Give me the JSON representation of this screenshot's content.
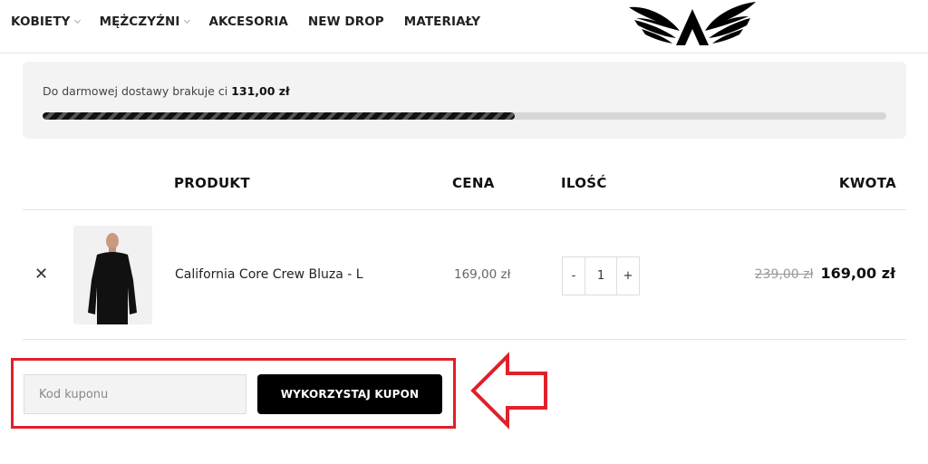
{
  "nav": {
    "items": [
      {
        "label": "KOBIETY",
        "has_dropdown": true
      },
      {
        "label": "MĘŻCZYŹNI",
        "has_dropdown": true
      },
      {
        "label": "AKCESORIA",
        "has_dropdown": false
      },
      {
        "label": "NEW DROP",
        "has_dropdown": false
      },
      {
        "label": "MATERIAŁY",
        "has_dropdown": false
      }
    ],
    "logo_icon": "winged-a-logo"
  },
  "shipping": {
    "text": "Do darmowej dostawy brakuje ci ",
    "amount": "131,00 zł",
    "progress": 0.56
  },
  "cart": {
    "headers": {
      "product": "PRODUKT",
      "price": "CENA",
      "quantity": "ILOŚĆ",
      "amount": "KWOTA"
    },
    "items": [
      {
        "remove_icon": "close-icon",
        "name": "California Core Crew Bluza - L",
        "price": "169,00 zł",
        "quantity": "1",
        "minus": "-",
        "plus": "+",
        "old_amount": "239,00 zł",
        "amount": "169,00 zł"
      }
    ]
  },
  "coupon": {
    "placeholder": "Kod kuponu",
    "value": "",
    "button_label": "WYKORZYSTAJ KUPON",
    "highlight_color": "#e0202a"
  },
  "colors": {
    "primary": "#000000",
    "accent_highlight": "#e0202a",
    "panel_bg": "#f3f3f3"
  }
}
